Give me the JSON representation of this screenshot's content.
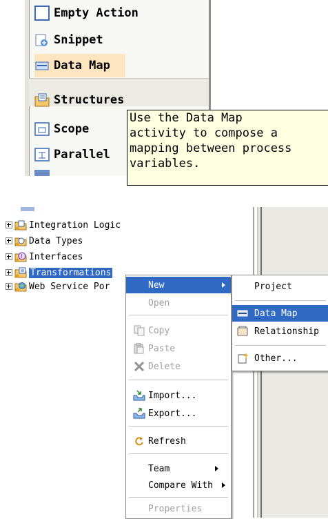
{
  "palette": {
    "items": [
      {
        "label": "Empty Action",
        "icon": "empty-action-icon"
      },
      {
        "label": "Snippet",
        "icon": "snippet-icon"
      },
      {
        "label": "Data Map",
        "icon": "data-map-icon"
      },
      {
        "label": "Structures",
        "icon": "structures-folder-icon"
      },
      {
        "label": "Scope",
        "icon": "scope-icon"
      },
      {
        "label": "Parallel",
        "icon": "parallel-icon"
      }
    ],
    "tooltip": "Use the Data Map\nactivity to compose a\nmapping between process\nvariables."
  },
  "tree": {
    "items": [
      {
        "label": "Integration Logic",
        "icon": "integration-logic-folder-icon"
      },
      {
        "label": "Data Types",
        "icon": "data-types-folder-icon"
      },
      {
        "label": "Interfaces",
        "icon": "interfaces-folder-icon"
      },
      {
        "label": "Transformations",
        "icon": "transformations-folder-icon"
      },
      {
        "label": "Web Service Por",
        "icon": "web-service-ports-icon"
      }
    ]
  },
  "context_menu": {
    "new": "New",
    "open": "Open",
    "copy": "Copy",
    "paste": "Paste",
    "delete": "Delete",
    "import": "Import...",
    "export": "Export...",
    "refresh": "Refresh",
    "team": "Team",
    "compare_with": "Compare With",
    "properties": "Properties"
  },
  "submenu": {
    "project": "Project",
    "data_map": "Data Map",
    "relationship": "Relationship",
    "other": "Other..."
  }
}
